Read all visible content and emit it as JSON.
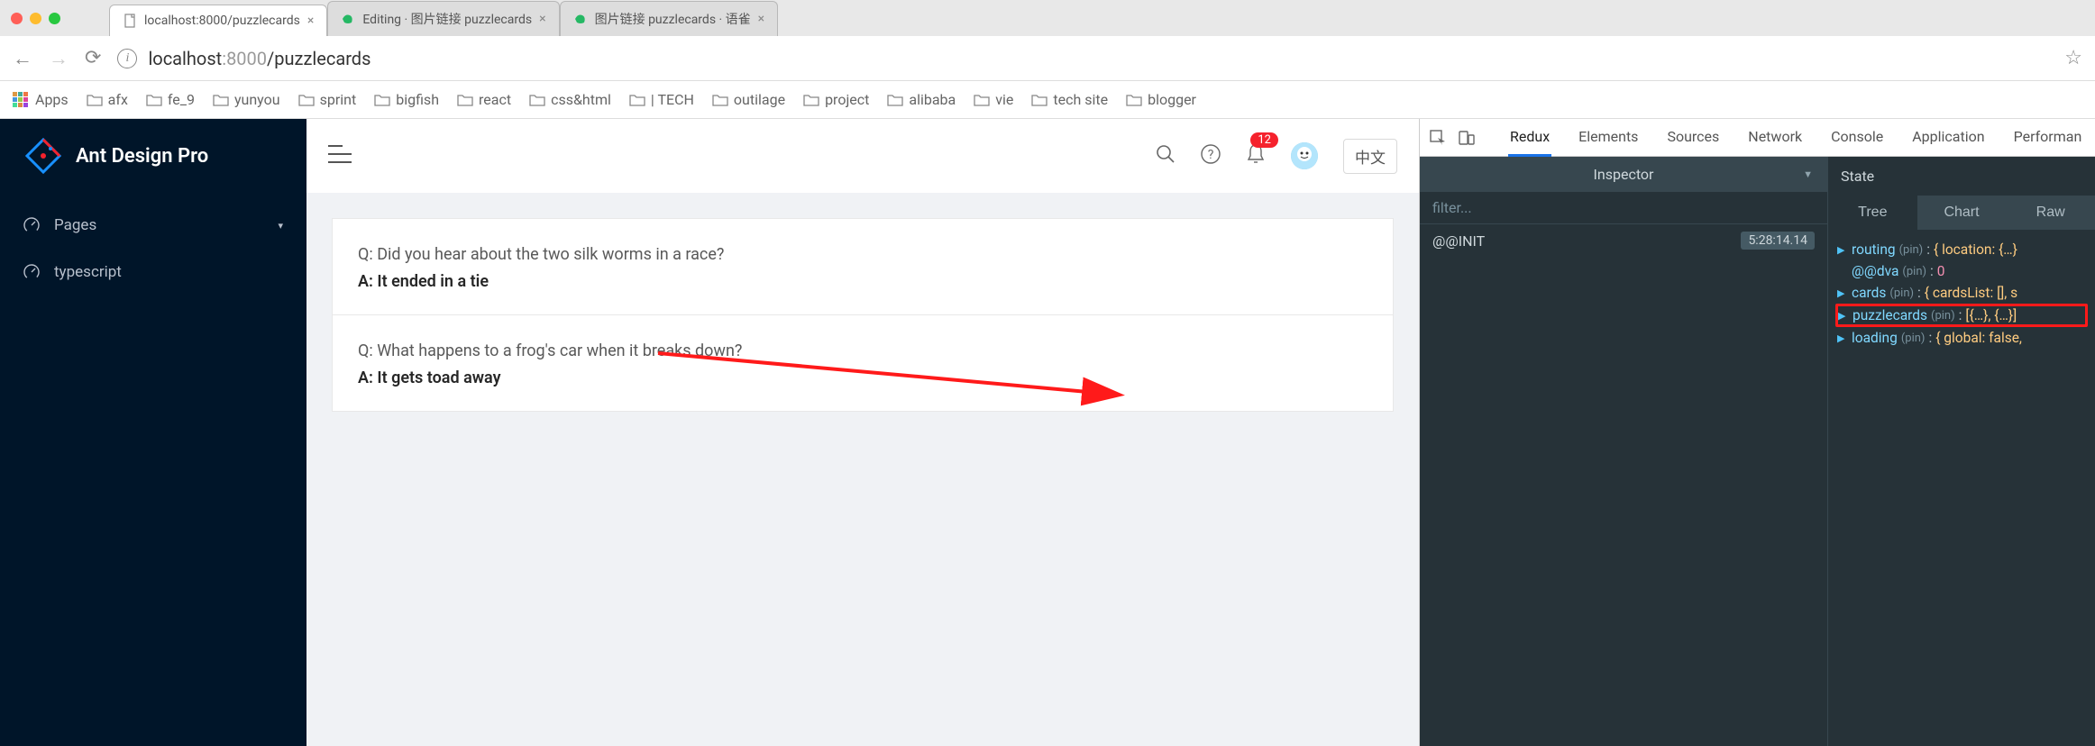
{
  "browser": {
    "tabs": [
      {
        "title": "localhost:8000/puzzlecards",
        "active": true,
        "icon": "page"
      },
      {
        "title": "Editing · 图片链接 puzzlecards",
        "active": false,
        "icon": "yuque"
      },
      {
        "title": "图片链接 puzzlecards · 语雀",
        "active": false,
        "icon": "yuque"
      }
    ],
    "address": {
      "host": "localhost",
      "port": ":8000",
      "path": "/puzzlecards"
    },
    "bookmarks": {
      "apps_label": "Apps",
      "items": [
        "afx",
        "fe_9",
        "yunyou",
        "sprint",
        "bigfish",
        "react",
        "css&html",
        "| TECH",
        "outilage",
        "project",
        "alibaba",
        "vie",
        "tech site",
        "blogger"
      ]
    }
  },
  "app": {
    "brand": "Ant Design Pro",
    "nav": [
      {
        "label": "Pages",
        "icon": "dashboard",
        "expandable": true
      },
      {
        "label": "typescript",
        "icon": "dashboard",
        "expandable": false
      }
    ],
    "header": {
      "notifications_count": "12",
      "lang_label": "中文"
    },
    "cards": [
      {
        "q": "Q: Did you hear about the two silk worms in a race?",
        "a": "A: It ended in a tie"
      },
      {
        "q": "Q: What happens to a frog's car when it breaks down?",
        "a": "A: It gets toad away"
      }
    ]
  },
  "devtools": {
    "tabs": [
      "Redux",
      "Elements",
      "Sources",
      "Network",
      "Console",
      "Application",
      "Performan"
    ],
    "active_tab": "Redux",
    "inspector_label": "Inspector",
    "filter_placeholder": "filter...",
    "actions": [
      {
        "name": "@@INIT",
        "time": "5:28:14.14"
      }
    ],
    "state_label": "State",
    "subtabs": [
      "Tree",
      "Chart",
      "Raw"
    ],
    "active_subtab": "Tree",
    "tree": [
      {
        "key": "routing",
        "val": "{ location: {…}",
        "caret": true
      },
      {
        "key": "@@dva",
        "val_num": "0",
        "caret": false
      },
      {
        "key": "cards",
        "val": "{ cardsList: [], s",
        "caret": true
      },
      {
        "key": "puzzlecards",
        "val": "[{…}, {…}]",
        "caret": true,
        "hl": true
      },
      {
        "key": "loading",
        "val": "{ global: false,",
        "caret": true
      }
    ]
  }
}
